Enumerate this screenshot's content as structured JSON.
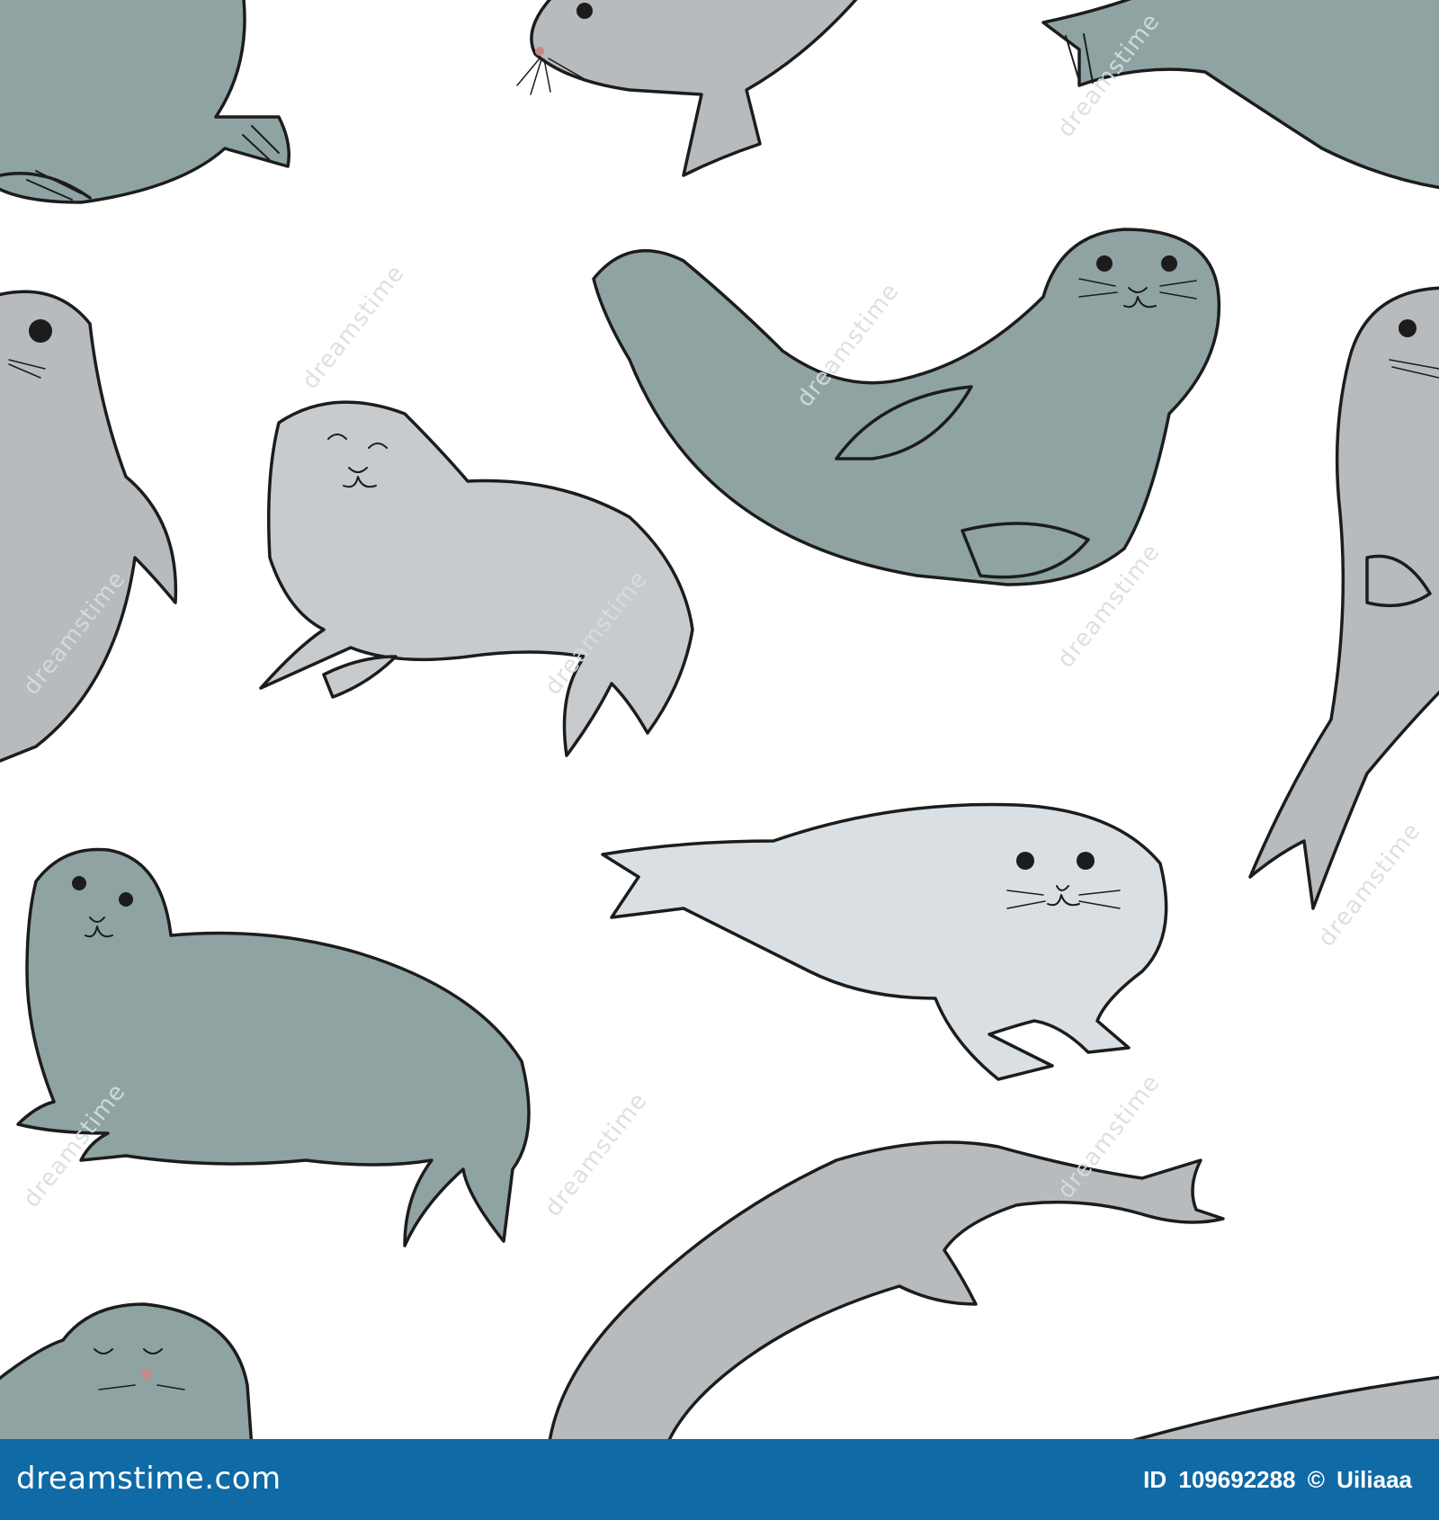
{
  "colors": {
    "seal_dark": "#8fa3a3",
    "seal_mid": "#b7bbbe",
    "seal_light": "#d9dfe2",
    "outline": "#1c1c1c",
    "footer_bg": "#0f6aa6",
    "footer_text": "#ffffff",
    "watermark": "#d9dde0"
  },
  "watermark": {
    "text": "dreamstime"
  },
  "footer": {
    "brand": "dreamstime.com",
    "id_label": "ID",
    "id_value": "109692288",
    "copyright_symbol": "©",
    "author": "Uiliaaa"
  }
}
